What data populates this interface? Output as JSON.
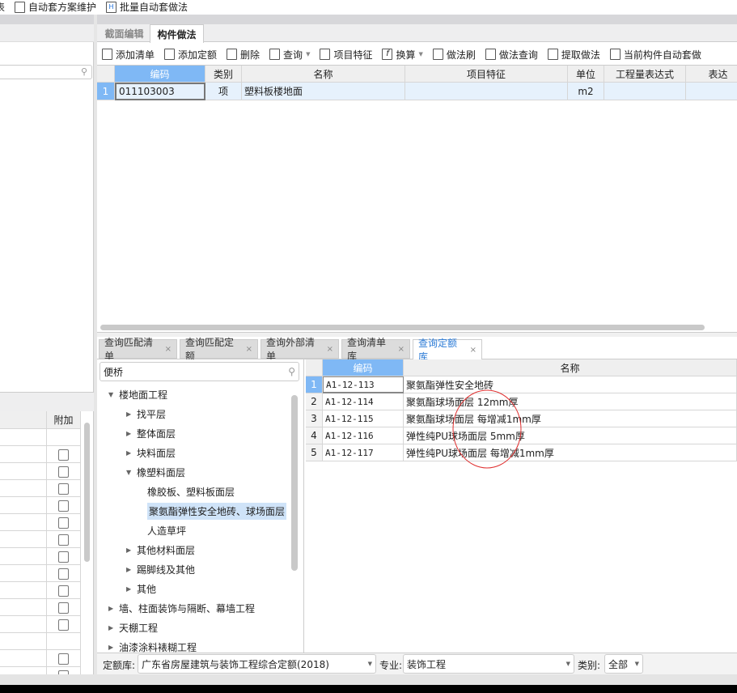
{
  "top_toolbar": {
    "cut_label": "表",
    "items": [
      {
        "label": "自动套方案维护",
        "icon": "auto-scheme-icon"
      },
      {
        "label": "批量自动套做法",
        "icon": "batch-auto-icon"
      }
    ]
  },
  "right_tabs": [
    {
      "label": "截面编辑",
      "active": false
    },
    {
      "label": "构件做法",
      "active": true
    }
  ],
  "toolbar": [
    {
      "label": "添加清单",
      "icon": "add-list-icon"
    },
    {
      "label": "添加定额",
      "icon": "add-quota-icon"
    },
    {
      "label": "删除",
      "icon": "delete-icon"
    },
    {
      "label": "查询",
      "icon": "query-icon",
      "dropdown": true
    },
    {
      "label": "项目特征",
      "icon": "feature-icon"
    },
    {
      "label": "换算",
      "icon": "fx-icon",
      "dropdown": true
    },
    {
      "label": "做法刷",
      "icon": "brush-icon"
    },
    {
      "label": "做法查询",
      "icon": "method-query-icon"
    },
    {
      "label": "提取做法",
      "icon": "extract-icon"
    },
    {
      "label": "当前构件自动套做",
      "icon": "auto-apply-icon"
    }
  ],
  "main_grid": {
    "columns": [
      "编码",
      "类别",
      "名称",
      "项目特征",
      "单位",
      "工程量表达式",
      "表达"
    ],
    "rows": [
      {
        "num": "1",
        "code": "011103003",
        "type": "项",
        "name": "塑料板楼地面",
        "feature": "",
        "unit": "m2",
        "expr": ""
      }
    ]
  },
  "bottom_tabs": [
    {
      "label": "查询匹配清单"
    },
    {
      "label": "查询匹配定额"
    },
    {
      "label": "查询外部清单"
    },
    {
      "label": "查询清单库"
    },
    {
      "label": "查询定额库",
      "active": true
    }
  ],
  "search": {
    "value": "便桥"
  },
  "tree": [
    {
      "label": "楼地面工程",
      "level": 0,
      "expanded": true
    },
    {
      "label": "找平层",
      "level": 1
    },
    {
      "label": "整体面层",
      "level": 1
    },
    {
      "label": "块料面层",
      "level": 1
    },
    {
      "label": "橡塑料面层",
      "level": 1,
      "expanded": true
    },
    {
      "label": "橡胶板、塑料板面层",
      "level": 2
    },
    {
      "label": "聚氨酯弹性安全地砖、球场面层",
      "level": 2,
      "selected": true
    },
    {
      "label": "人造草坪",
      "level": 2
    },
    {
      "label": "其他材料面层",
      "level": 1
    },
    {
      "label": "踢脚线及其他",
      "level": 1
    },
    {
      "label": "其他",
      "level": 1
    },
    {
      "label": "墙、柱面装饰与隔断、幕墙工程",
      "level": 0
    },
    {
      "label": "天棚工程",
      "level": 0
    },
    {
      "label": "油漆涂料裱糊工程",
      "level": 0
    }
  ],
  "quota_grid": {
    "columns": [
      "编码",
      "名称"
    ],
    "rows": [
      {
        "num": "1",
        "code": "A1-12-113",
        "name": "聚氨酯弹性安全地砖"
      },
      {
        "num": "2",
        "code": "A1-12-114",
        "name": "聚氨酯球场面层 12mm厚"
      },
      {
        "num": "3",
        "code": "A1-12-115",
        "name": "聚氨酯球场面层 每增减1mm厚"
      },
      {
        "num": "4",
        "code": "A1-12-116",
        "name": "弹性纯PU球场面层 5mm厚"
      },
      {
        "num": "5",
        "code": "A1-12-117",
        "name": "弹性纯PU球场面层 每增减1mm厚"
      }
    ]
  },
  "filters": {
    "library_label": "定额库:",
    "library_value": "广东省房屋建筑与装饰工程综合定额(2018)",
    "major_label": "专业:",
    "major_value": "装饰工程",
    "category_label": "类别:",
    "category_value": "全部"
  },
  "left_table": {
    "column": "附加"
  },
  "colors": {
    "selected_header": "#7fb8f5",
    "selected_row": "#e6f1fc",
    "tree_selected": "#cfe3f8",
    "annotation": "#e03030",
    "active_tab_text": "#2a7ad6"
  }
}
